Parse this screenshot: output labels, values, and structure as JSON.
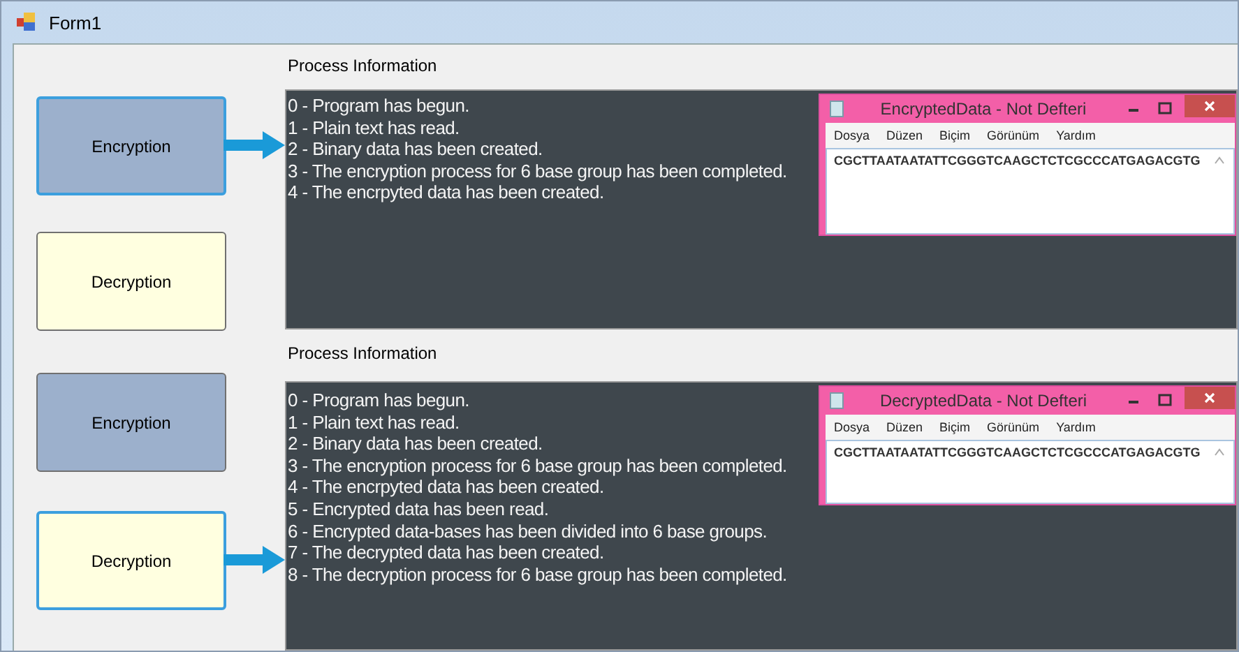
{
  "window": {
    "title": "Form1"
  },
  "sections": [
    {
      "label": "Process Information",
      "buttons": [
        {
          "label": "Encryption",
          "color": "#9cb0cc",
          "focused": true
        },
        {
          "label": "Decryption",
          "color": "#ffffe0",
          "focused": false
        }
      ],
      "log": [
        "0 - Program has begun.",
        "1 - Plain text has read.",
        "2 - Binary data has been created.",
        "3 - The encryption process for 6 base group has been completed.",
        "4 - The encrpyted data has been created."
      ],
      "notepad": {
        "title": "EncryptedData - Not Defteri",
        "menu": [
          "Dosya",
          "Düzen",
          "Biçim",
          "Görünüm",
          "Yardım"
        ],
        "content": "CGCTTAATAATATTCGGGTCAAGCTCTCGCCCATGAGACGTG"
      }
    },
    {
      "label": "Process Information",
      "buttons": [
        {
          "label": "Encryption",
          "color": "#9cb0cc",
          "focused": false
        },
        {
          "label": "Decryption",
          "color": "#ffffe0",
          "focused": true
        }
      ],
      "log": [
        "0 - Program has begun.",
        "1 - Plain text has read.",
        "2 - Binary data has been created.",
        "3 - The encryption process for 6 base group has been completed.",
        "4 - The encrpyted data has been created.",
        "5 - Encrypted data has been read.",
        "6 - Encrypted data-bases has been divided into 6 base groups.",
        "7 - The decrypted data has been created.",
        "8 - The decryption process for 6 base group has been completed."
      ],
      "notepad": {
        "title": "DecryptedData - Not Defteri",
        "menu": [
          "Dosya",
          "Düzen",
          "Biçim",
          "Görünüm",
          "Yardım"
        ],
        "content": "CGCTTAATAATATTCGGGTCAAGCTCTCGCCCATGAGACGTG"
      }
    }
  ]
}
